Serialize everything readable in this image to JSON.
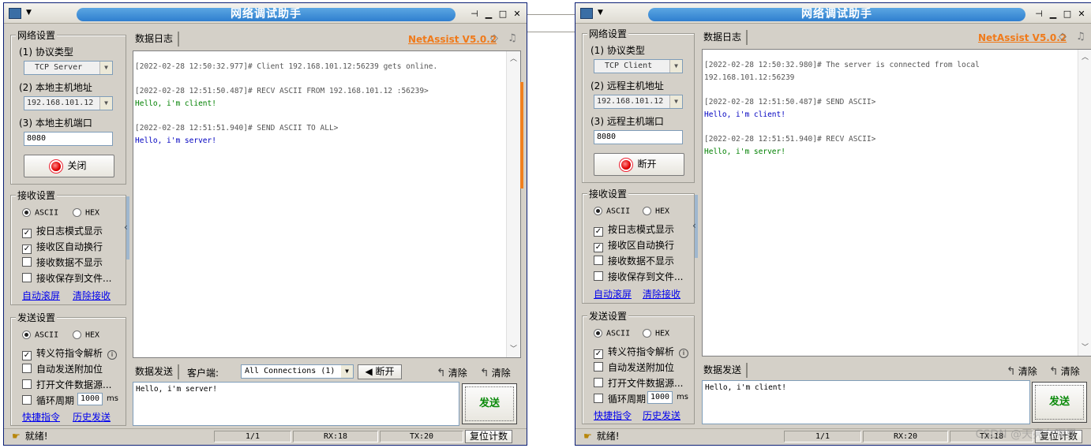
{
  "window_title": "网络调试助手",
  "brand": "NetAssist V5.0.2",
  "icons": {
    "sys": "app-icon",
    "pin": "pin-icon",
    "min": "minimize-icon",
    "max": "maximize-icon",
    "close": "close-icon"
  },
  "common": {
    "net_group": "网络设置",
    "recv_group": "接收设置",
    "send_group": "发送设置",
    "log_tab": "数据日志",
    "send_tab": "数据发送",
    "ascii": "ASCII",
    "hex": "HEX",
    "log_mode": "按日志模式显示",
    "auto_wrap": "接收区自动换行",
    "hide_recv": "接收数据不显示",
    "save_file": "接收保存到文件...",
    "auto_scroll": "自动滚屏",
    "clear_recv": "清除接收",
    "escape_parse": "转义符指令解析",
    "auto_append": "自动发送附加位",
    "open_file": "打开文件数据源...",
    "loop_period": "循环周期",
    "ms": "ms",
    "period_value": "1000",
    "shortcuts": "快捷指令",
    "history": "历史发送",
    "clear": "清除",
    "send": "发送",
    "ready": "就绪!",
    "reset": "复位计数",
    "port": "8080",
    "ip": "192.168.101.12"
  },
  "left": {
    "protocol_label": "(1) 协议类型",
    "protocol": "TCP Server",
    "host_label": "(2) 本地主机地址",
    "port_label": "(3) 本地主机端口",
    "connect_btn": "关闭",
    "client_label": "客户端:",
    "client_value": "All Connections (1)",
    "disconnect_btn": "断开",
    "log": [
      {
        "hdr": "[2022-02-28 12:50:32.977]# Client 192.168.101.12:56239 gets online.",
        "body": ""
      },
      {
        "hdr": "[2022-02-28 12:51:50.487]# RECV ASCII FROM 192.168.101.12 :56239>",
        "body": "Hello, i'm client!"
      },
      {
        "hdr": "[2022-02-28 12:51:51.940]# SEND ASCII TO ALL>",
        "body": "Hello, i'm server!"
      }
    ],
    "send_text": "Hello, i'm server!",
    "status_page": "1/1",
    "rx": "RX:18",
    "tx": "TX:20"
  },
  "right": {
    "protocol_label": "(1) 协议类型",
    "protocol": "TCP Client",
    "host_label": "(2) 远程主机地址",
    "port_label": "(3) 远程主机端口",
    "connect_btn": "断开",
    "log": [
      {
        "hdr": "[2022-02-28 12:50:32.980]# The server is connected from local",
        "hdr2": "192.168.101.12:56239",
        "body": ""
      },
      {
        "hdr": "[2022-02-28 12:51:50.487]# SEND ASCII>",
        "body": "Hello, i'm client!"
      },
      {
        "hdr": "[2022-02-28 12:51:51.940]# RECV ASCII>",
        "body": "Hello, i'm server!"
      }
    ],
    "send_text": "Hello, i'm client!",
    "status_page": "1/1",
    "rx": "RX:20",
    "tx": "TX:18"
  },
  "watermark": "CSDN @天亮在哪里"
}
